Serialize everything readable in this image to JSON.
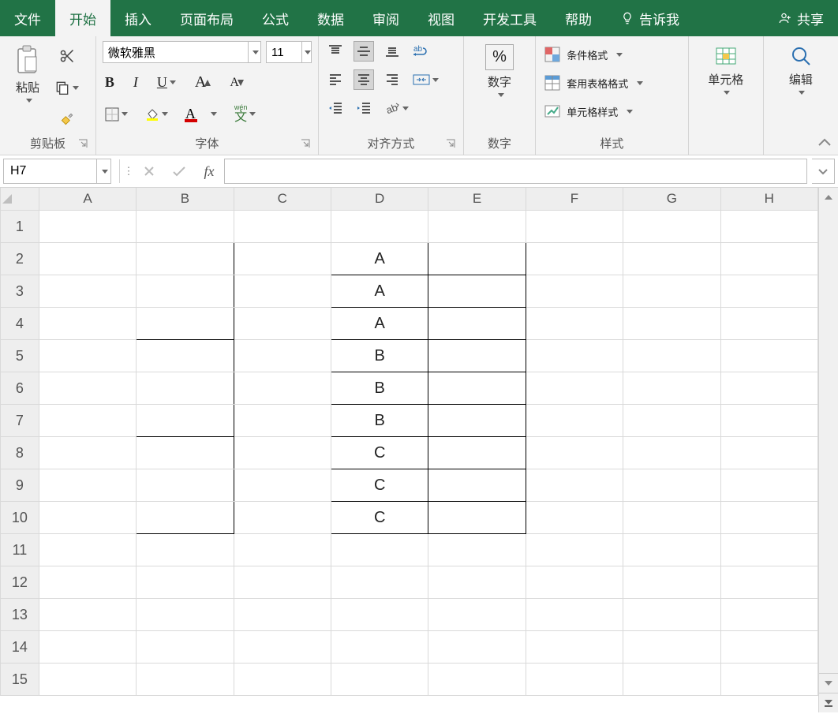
{
  "tabs": {
    "file": "文件",
    "home": "开始",
    "insert": "插入",
    "pagelayout": "页面布局",
    "formulas": "公式",
    "data": "数据",
    "review": "审阅",
    "view": "视图",
    "developer": "开发工具",
    "help": "帮助",
    "tellme": "告诉我",
    "share": "共享"
  },
  "ribbon": {
    "clipboard": {
      "paste": "粘贴",
      "label": "剪贴板"
    },
    "font": {
      "name": "微软雅黑",
      "size": "11",
      "wen": "wén",
      "wenchar": "文",
      "label": "字体"
    },
    "align": {
      "label": "对齐方式"
    },
    "number": {
      "big": "数字",
      "label": "数字"
    },
    "styles": {
      "cond": "条件格式",
      "table": "套用表格格式",
      "cell": "单元格样式",
      "label": "样式"
    },
    "cells": {
      "label": "单元格"
    },
    "editing": {
      "label": "编辑"
    }
  },
  "formulaBar": {
    "name": "H7",
    "fx": "fx",
    "value": ""
  },
  "columns": [
    "A",
    "B",
    "C",
    "D",
    "E",
    "F",
    "G",
    "H"
  ],
  "rows": [
    "1",
    "2",
    "3",
    "4",
    "5",
    "6",
    "7",
    "8",
    "9",
    "10",
    "11",
    "12",
    "13",
    "14",
    "15"
  ],
  "cells": {
    "D2": "A",
    "D3": "A",
    "D4": "A",
    "D5": "B",
    "D6": "B",
    "D7": "B",
    "D8": "C",
    "D9": "C",
    "D10": "C"
  }
}
